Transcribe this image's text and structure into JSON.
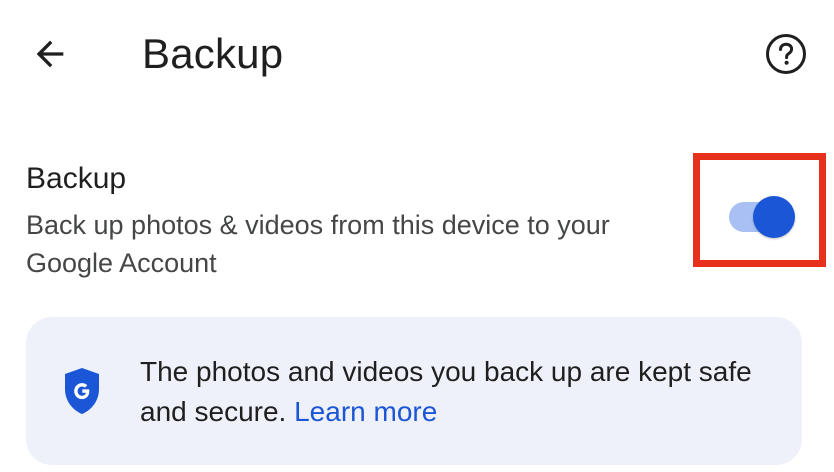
{
  "app_bar": {
    "title": "Backup",
    "back_icon": "arrow-back-icon",
    "help_icon": "help-circle-icon"
  },
  "backup_setting": {
    "title": "Backup",
    "description": "Back up photos & videos from this device to your Google Account",
    "toggle_state": "on"
  },
  "info_card": {
    "text": "The photos and videos you back up are kept safe and secure.",
    "link_label": "Learn more",
    "icon": "google-shield-icon"
  },
  "colors": {
    "accent": "#1a56d6",
    "toggle_track": "#a8c0f4",
    "highlight": "#e8311c",
    "card_bg": "#eef1f9"
  }
}
